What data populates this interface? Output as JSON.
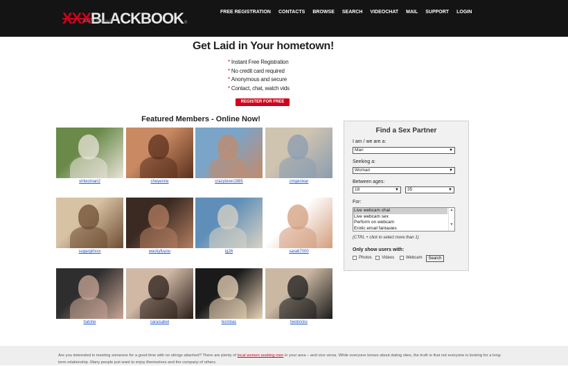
{
  "header": {
    "logo_red": "XXX",
    "logo_white": "BLACKBOOK",
    "logo_tm": "®",
    "tagline": "Adults at play®",
    "nav": [
      "FREE REGISTRATION",
      "CONTACTS",
      "BROWSE",
      "SEARCH",
      "VIDEOCHAT",
      "MAIL",
      "SUPPORT",
      "LOGIN"
    ]
  },
  "hero": {
    "headline": "Get Laid in Your hometown!",
    "bullets": [
      "Instant Free Registration",
      "No credit card required",
      "Anonymous and secure",
      "Contact, chat, watch vids"
    ],
    "register_button": "REGISTER FOR FREE"
  },
  "featured": {
    "title": "Featured Members - Online Now!",
    "members": [
      "virtwoman2",
      "cheyenne",
      "crazylover1985",
      "cmgenixar",
      "sugargirlxxx",
      "wackyfuyou",
      "ig26",
      "sara67000",
      "hatshe",
      "caraisabel",
      "bombas",
      "twobricks"
    ],
    "photo_colors": [
      [
        "#6b8a4a",
        "#e9e4d8"
      ],
      [
        "#c98a63",
        "#5a2f1c"
      ],
      [
        "#7aa5c9",
        "#c48a6a"
      ],
      [
        "#cfc4b0",
        "#8a9cb0"
      ],
      [
        "#d8c2a4",
        "#6e4d33"
      ],
      [
        "#3a2a22",
        "#b37d60"
      ],
      [
        "#5f8fb8",
        "#d9d3c5"
      ],
      [
        "#ffffff",
        "#d39d7d"
      ],
      [
        "#2e2e2e",
        "#c9a596"
      ],
      [
        "#d0b8a5",
        "#2a1d18"
      ],
      [
        "#1a1a1a",
        "#e9d3b7"
      ],
      [
        "#cbb8a2",
        "#1b1b1b"
      ]
    ]
  },
  "search_panel": {
    "title": "Find a Sex Partner",
    "iam_label": "I am / we are a:",
    "iam_value": "Man",
    "seeking_label": "Seeking a:",
    "seeking_value": "Woman",
    "ages_label": "Between ages:",
    "age_min": "18",
    "age_max": "35",
    "for_label": "For:",
    "for_options": [
      "Live webcam chat",
      "Live webcam sex",
      "Perform on webcam",
      "Erotic email fantasies"
    ],
    "hint": "(CTRL + click to select more than 1)",
    "only_show_label": "Only show users with:",
    "filters": [
      "Photos",
      "Videos",
      "Webcam"
    ],
    "search_button": "Search"
  },
  "footer": {
    "text_1": "Are you interested in meeting someone for a good time with no strings attached? There are plenty of ",
    "link": "local women seeking men",
    "text_2": " in your area – and vice versa. While everyone knows about dating sites, the truth is that not everyone is looking for a long-term relationship. Many people just want to enjoy themselves and the company of others."
  }
}
